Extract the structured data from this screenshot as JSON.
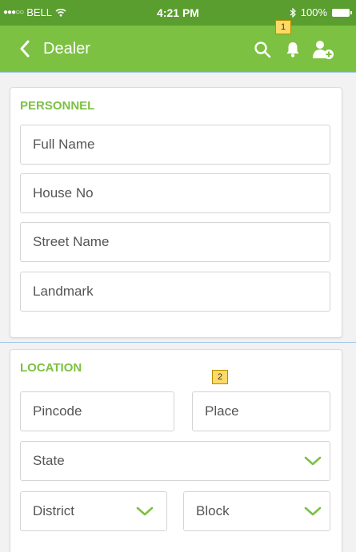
{
  "status_bar": {
    "carrier": "BELL",
    "time": "4:21 PM",
    "battery": "100%"
  },
  "app_bar": {
    "title": "Dealer",
    "icons": [
      "back-icon",
      "search-icon",
      "bell-icon",
      "add-person-icon"
    ]
  },
  "personnel": {
    "title": "PERSONNEL",
    "fields": [
      {
        "placeholder": "Full Name"
      },
      {
        "placeholder": "House No"
      },
      {
        "placeholder": "Street Name"
      },
      {
        "placeholder": "Landmark"
      }
    ]
  },
  "location": {
    "title": "LOCATION",
    "pincode": "Pincode",
    "place": "Place",
    "state": "State",
    "district": "District",
    "block": "Block"
  },
  "markers": [
    "1",
    "2"
  ],
  "colors": {
    "accent": "#7cc142",
    "status_bar": "#5a9e2f",
    "background": "#f2f2f2"
  }
}
